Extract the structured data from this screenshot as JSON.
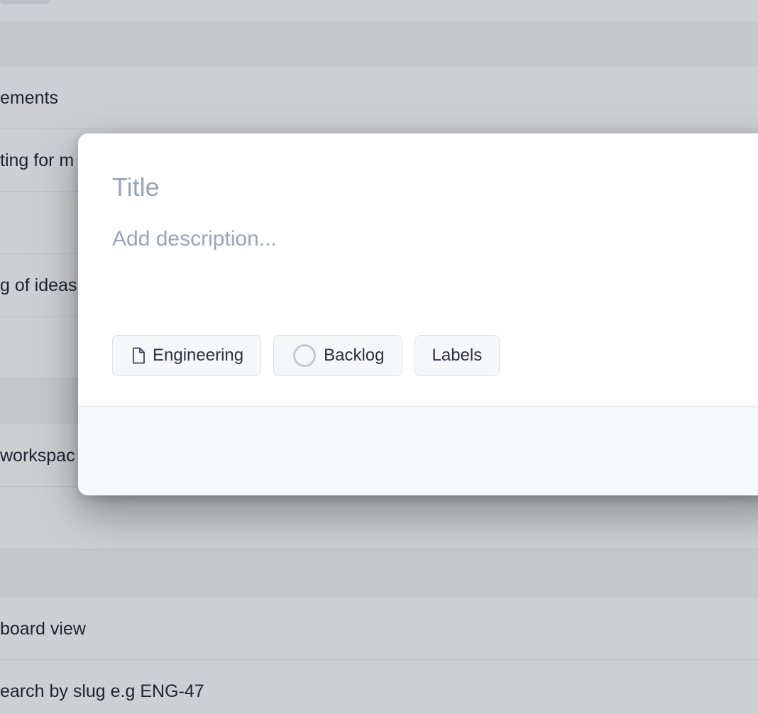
{
  "background_list": {
    "rows": [
      {
        "text": "ements"
      },
      {
        "text": "ting for m"
      },
      {
        "text": ""
      },
      {
        "text": "g of ideas"
      },
      {
        "text": ""
      },
      {
        "text": "workspac"
      },
      {
        "text": ""
      },
      {
        "text": "board view"
      },
      {
        "text": "earch by slug e.g ENG-47"
      }
    ]
  },
  "modal": {
    "title_placeholder": "Title",
    "description_placeholder": "Add description...",
    "chips": {
      "team": {
        "label": "Engineering",
        "icon": "document-icon"
      },
      "status": {
        "label": "Backlog",
        "icon": "circle-status-icon"
      },
      "labels": {
        "label": "Labels"
      }
    }
  },
  "colors": {
    "overlay": "#b8bcc4",
    "placeholder": "#9ba5b6",
    "text": "#1f2330",
    "chip_bg": "#f6f7f9",
    "chip_border": "#dde1e8",
    "footer_bg": "#f8f9fc"
  }
}
